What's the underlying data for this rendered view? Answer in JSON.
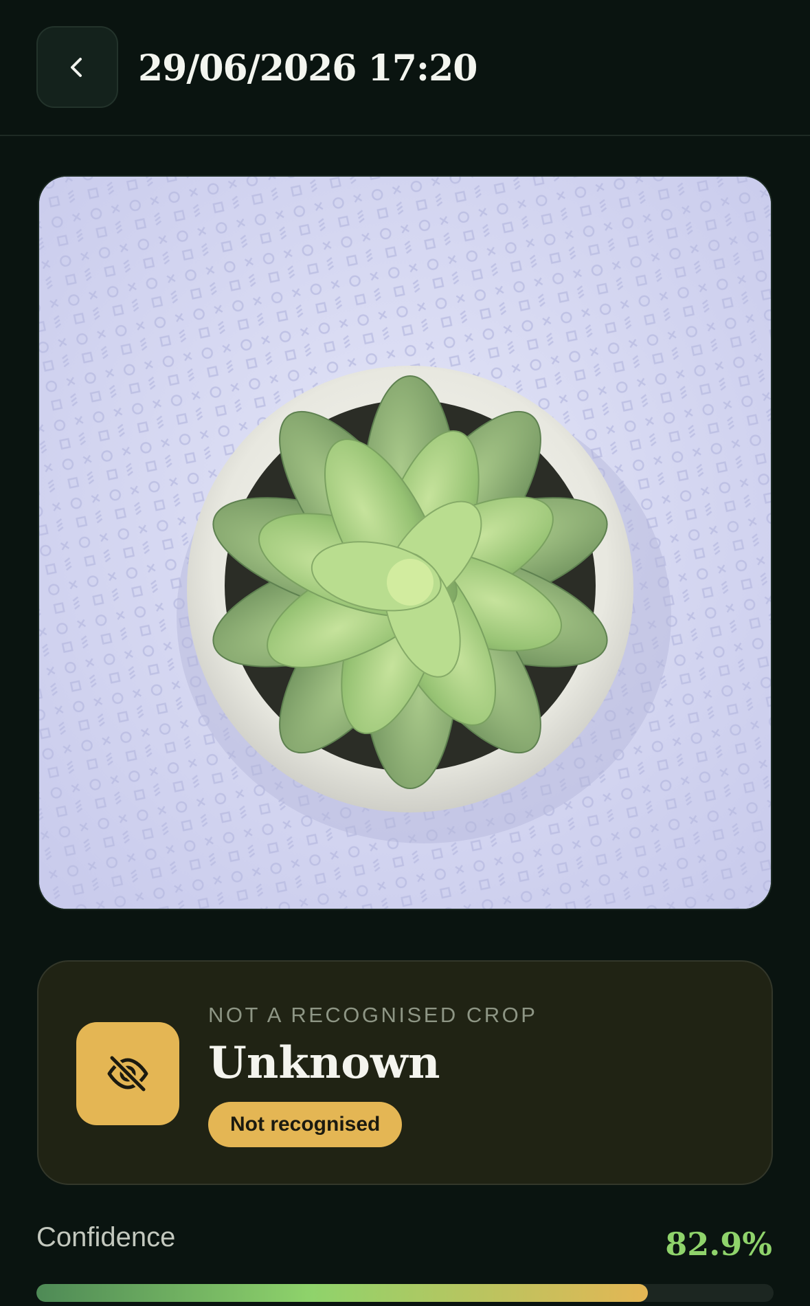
{
  "header": {
    "back_icon": "chevron-left-icon",
    "title": "29/06/2026 17:20"
  },
  "photo": {
    "subject": "succulent-plant-photo"
  },
  "result": {
    "icon": "eye-off-icon",
    "eyebrow": "NOT A RECOGNISED CROP",
    "name": "Unknown",
    "badge": "Not recognised"
  },
  "confidence": {
    "label": "Confidence",
    "value_text": "82.9%",
    "fraction": 0.829
  },
  "colors": {
    "background": "#0a1410",
    "accent_amber": "#e4b654",
    "accent_green": "#8fd36b",
    "card": "#202314"
  }
}
